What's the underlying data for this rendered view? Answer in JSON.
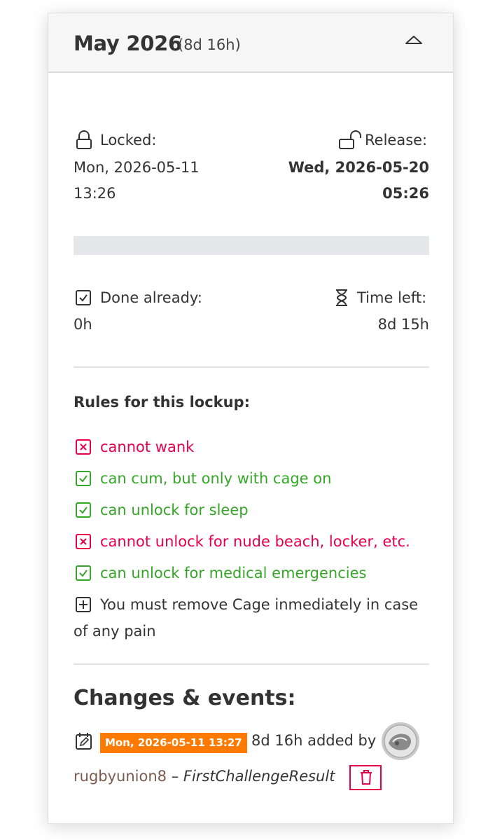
{
  "header": {
    "title": "May 2026",
    "duration": "(8d 16h)"
  },
  "lock": {
    "locked_label": "Locked:",
    "locked_date": "Mon, 2026-05-11",
    "locked_time": "13:26",
    "release_label": "Release:",
    "release_date": "Wed, 2026-05-20",
    "release_time": "05:26"
  },
  "progress": {
    "fraction": 0.0
  },
  "stats": {
    "done_label": "Done already:",
    "done_value": "0h",
    "left_label": "Time left:",
    "left_value": "8d 15h"
  },
  "rules": {
    "heading": "Rules for this lockup:",
    "items": [
      {
        "text": "cannot wank",
        "status": "denied"
      },
      {
        "text": "can cum, but only with cage on",
        "status": "allowed"
      },
      {
        "text": "can unlock for sleep",
        "status": "allowed"
      },
      {
        "text": "cannot unlock for nude beach, locker, etc.",
        "status": "denied"
      },
      {
        "text": "can unlock for medical emergencies",
        "status": "allowed"
      }
    ],
    "custom_line1": "You must remove Cage inmediately in case",
    "custom_line2": "of any pain"
  },
  "events": {
    "heading": "Changes & events:",
    "items": [
      {
        "timestamp": "Mon, 2026-05-11 13:27",
        "change": "8d 16h added by",
        "user": "rugbyunion8",
        "separator": "–",
        "reason": "FirstChallengeResult"
      }
    ]
  },
  "colors": {
    "allowed": "#35a628",
    "denied": "#e6004c",
    "badge": "#ff7a00",
    "user_link": "#7a5a4c",
    "progress_fill": "#3a9a3a"
  }
}
